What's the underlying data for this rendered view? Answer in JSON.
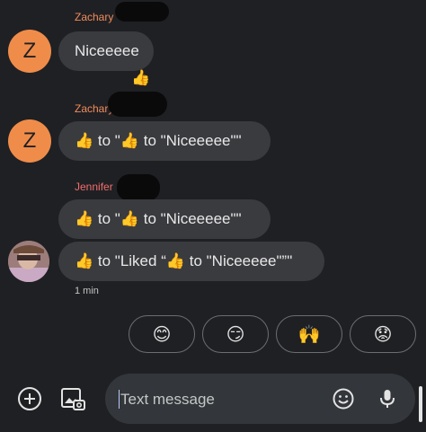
{
  "colors": {
    "background": "#1f2023",
    "bubble": "#3a3b3f",
    "avatar_orange": "#f08c4a",
    "sender_name": "#f28b5c",
    "jennifer_name": "#f26d6d"
  },
  "messages": [
    {
      "sender": "Zachary",
      "avatar_letter": "Z",
      "bubbles": [
        "Niceeeee"
      ],
      "reaction": "👍"
    },
    {
      "sender": "Zachary",
      "avatar_letter": "Z",
      "bubbles": [
        "👍 to \"👍 to \"Niceeeee\"\""
      ]
    },
    {
      "sender": "Jennifer",
      "bubbles": [
        "👍 to \"👍 to \"Niceeeee\"\"",
        "👍 to \"Liked “👍 to \"Niceeeee\"”\""
      ],
      "time": "1 min"
    }
  ],
  "suggestions": [
    "😊",
    "😏",
    "🙌",
    "😟"
  ],
  "composer": {
    "placeholder": "Text message",
    "add_icon": "plus-circle-icon",
    "gallery_icon": "gallery-icon",
    "emoji_icon": "emoji-icon",
    "mic_icon": "mic-icon"
  }
}
